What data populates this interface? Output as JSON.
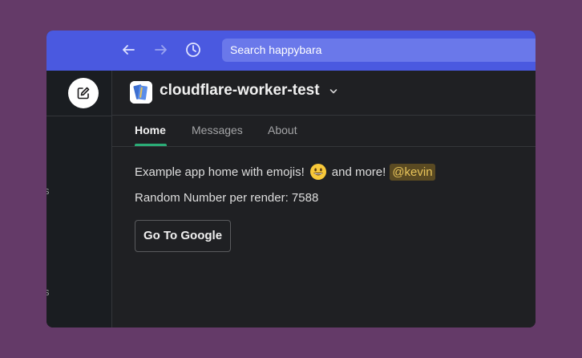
{
  "search": {
    "label": "Search happybara"
  },
  "sidebar": {
    "fragments": [
      "s",
      "s"
    ]
  },
  "app": {
    "name": "cloudflare-worker-test"
  },
  "tabs": [
    {
      "label": "Home",
      "active": true
    },
    {
      "label": "Messages",
      "active": false
    },
    {
      "label": "About",
      "active": false
    }
  ],
  "content": {
    "line1_before": "Example app home with emojis!",
    "line1_after": "and more!",
    "mention": "@kevin",
    "line2": "Random Number per render: 7588",
    "button_label": "Go To Google"
  },
  "colors": {
    "background": "#643a68",
    "topbar": "#4a59e0",
    "search_bg": "#6a78ea",
    "panel": "#1f2023",
    "active_tab_underline": "#2bac76",
    "mention_text": "#e8c45a",
    "mention_bg": "#5a4a22"
  },
  "icons": {
    "back": "arrow-left-icon",
    "forward": "arrow-right-icon",
    "history": "clock-icon",
    "compose": "compose-icon",
    "app": "app-book-icon",
    "chevron": "chevron-down-icon",
    "emoji": "grinning-face-emoji"
  }
}
